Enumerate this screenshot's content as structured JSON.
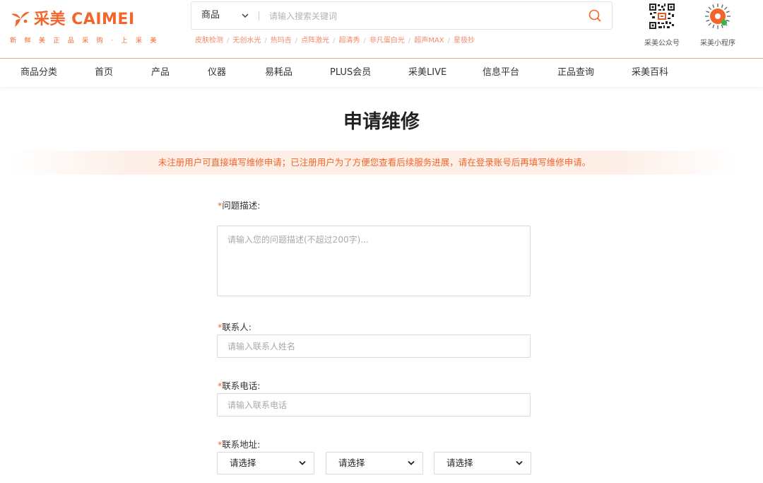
{
  "brand": {
    "name": "采美 CAIMEI",
    "slogan": "新 鲜 美 正 品 采 购 · 上 采 美",
    "accent_color": "#f2652b"
  },
  "search": {
    "category": "商品",
    "placeholder": "请输入搜索关键词",
    "hot_words": [
      "皮肤检测",
      "无创水光",
      "热玛吉",
      "点阵激光",
      "超清秀",
      "非凡蛋白光",
      "超声MAX",
      "星极抄"
    ]
  },
  "qr_codes": [
    {
      "label": "采美公众号",
      "icon": "qr-code-icon"
    },
    {
      "label": "采美小程序",
      "icon": "mini-program-code-icon"
    }
  ],
  "nav": {
    "items": [
      "商品分类",
      "首页",
      "产品",
      "仪器",
      "易耗品",
      "PLUS会员",
      "采美LIVE",
      "信息平台",
      "正品查询",
      "采美百科"
    ]
  },
  "page": {
    "title": "申请维修",
    "notice": "未注册用户可直接填写维修申请；已注册用户为了方便您查看后续服务进展，请在登录账号后再填写维修申请。"
  },
  "form": {
    "required_mark": "*",
    "description": {
      "label": "问题描述:",
      "placeholder": "请输入您的问题描述(不超过200字)...",
      "value": ""
    },
    "contact": {
      "label": "联系人:",
      "placeholder": "请输入联系人姓名",
      "value": ""
    },
    "phone": {
      "label": "联系电话:",
      "placeholder": "请输入联系电话",
      "value": ""
    },
    "address": {
      "label": "联系地址:",
      "selects": [
        "请选择",
        "请选择",
        "请选择"
      ]
    }
  }
}
